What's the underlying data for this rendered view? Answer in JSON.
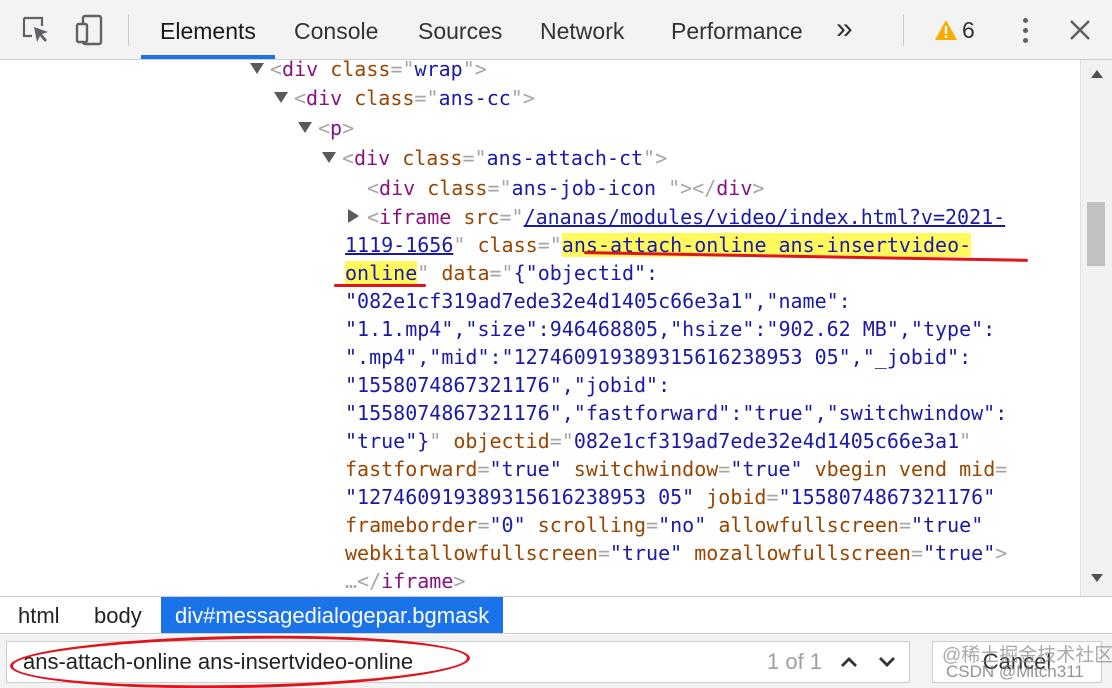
{
  "toolbar": {
    "tabs": [
      "Elements",
      "Console",
      "Sources",
      "Network",
      "Performance"
    ],
    "more_tabs_glyph": "»",
    "warning_count": "6",
    "icons": [
      "inspect-icon",
      "device-toggle-icon",
      "warning-icon",
      "more-options-icon",
      "close-icon"
    ]
  },
  "code": {
    "l1": {
      "open": "<",
      "tag": "div",
      "attr": "class",
      "eq": "=\"",
      "val": "wrap",
      "close": "\">"
    },
    "l2": {
      "open": "<",
      "tag": "div",
      "attr": "class",
      "eq": "=\"",
      "val": "ans-cc",
      "close": "\">"
    },
    "l3": {
      "open": "<",
      "tag": "p",
      "close": ">"
    },
    "l4": {
      "open": "<",
      "tag": "div",
      "attr": "class",
      "eq": "=\"",
      "val": "ans-attach-ct",
      "close": "\">"
    },
    "l5": {
      "open": "<",
      "tag": "div",
      "attr": "class",
      "eq": "=\"",
      "val": "ans-job-icon ",
      "close": "\"></",
      "tag2": "div",
      "end": ">"
    },
    "l6": {
      "open": "<",
      "tag": "iframe",
      "attr": "src",
      "eq": "=\"",
      "link": "/ananas/modules/video/index.html?v=2021-"
    },
    "l7": {
      "link": "1119-1656",
      "q": "\"",
      "attr": "class",
      "eq": "=\"",
      "hl": "ans-attach-online ans-insertvideo-"
    },
    "l8": {
      "hl": "online",
      "q": "\"",
      "attr": "data",
      "eq": "=\"",
      "val": "{\"objectid\":"
    },
    "l9": "\"082e1cf319ad7ede32e4d1405c66e3a1\",\"name\":",
    "l10": "\"1.1.mp4\",\"size\":946468805,\"hsize\":\"902.62 MB\",\"type\":",
    "l11": "\".mp4\",\"mid\":\"127460919389315616238953 05\",\"_jobid\":",
    "l12": "\"1558074867321176\",\"jobid\":",
    "l13": "\"1558074867321176\",\"fastforward\":\"true\",\"switchwindow\":",
    "l14": {
      "val": "\"true\"}",
      "q": "\"",
      "attr": "objectid",
      "eq": "=\"",
      "val2": "082e1cf319ad7ede32e4d1405c66e3a1",
      "q2": "\""
    },
    "l15": {
      "a1": "fastforward",
      "v1": "\"true\"",
      "a2": "switchwindow",
      "v2": "\"true\"",
      "a3": "vbegin vend mid",
      "eq": "="
    },
    "l16": {
      "v1": "\"127460919389315616238953 05\"",
      "a1": "jobid",
      "v2": "\"1558074867321176\""
    },
    "l17": {
      "a1": "frameborder",
      "v1": "\"0\"",
      "a2": "scrolling",
      "v2": "\"no\"",
      "a3": "allowfullscreen",
      "v3": "\"true\""
    },
    "l18": {
      "a1": "webkitallowfullscreen",
      "v1": "\"true\"",
      "a2": "mozallowfullscreen",
      "v2": "\"true\"",
      "close": ">"
    },
    "l19": {
      "dots": "…",
      "open": "</",
      "tag": "iframe",
      "close": ">"
    }
  },
  "breadcrumbs": [
    "html",
    "body",
    "div#messagedialogepar.bgmask"
  ],
  "search": {
    "value": "ans-attach-online ans-insertvideo-online",
    "match_count": "1 of 1",
    "cancel_label": "Cancel"
  },
  "watermark": {
    "line1": "@稀土掘金技术社区",
    "line2": "CSDN @Mitch311"
  },
  "colors": {
    "tag": "#881280",
    "attribute": "#994500",
    "value": "#1a1aa6",
    "punctuation": "#a6a6a6",
    "highlight": "#fff95c",
    "selected": "#1a73e8",
    "annotation": "#e0151b"
  }
}
